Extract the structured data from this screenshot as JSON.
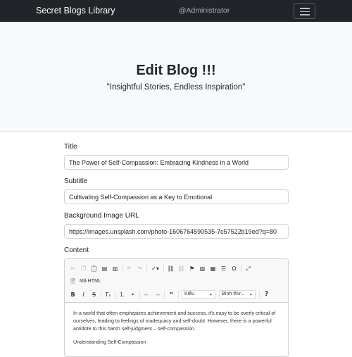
{
  "navbar": {
    "brand": "Secret Blogs Library",
    "user": "@Administrator",
    "toggler_icon": "hamburger-icon"
  },
  "hero": {
    "title": "Edit Blog !!!",
    "tagline": "\"Insightful Stories, Endless Inspiration\""
  },
  "form": {
    "title_label": "Title",
    "title_value": "The Power of Self-Compassion: Embracing Kindness in a World",
    "subtitle_label": "Subtitle",
    "subtitle_value": "Cultivating Self-Compassion as a Key to Emotional",
    "bg_label": "Background Image URL",
    "bg_value": "https://images.unsplash.com/photo-1606764590535-7c57522b19ed?q=80",
    "content_label": "Content"
  },
  "editor": {
    "source_label": "Mã HTML",
    "style_select": "Kiểu",
    "format_select": "Bình thư...",
    "help_label": "?",
    "paragraph_1": "In a world that often emphasizes achievement and success, it's easy to be overly critical of ourselves, leading to feelings of inadequacy and self-doubt. However, there is a powerful antidote to this harsh self-judgment – self-compassion.",
    "paragraph_2": "Understanding Self-Compassion"
  }
}
